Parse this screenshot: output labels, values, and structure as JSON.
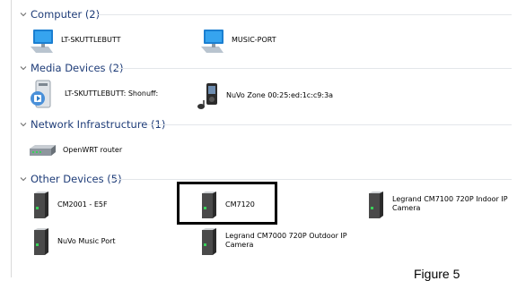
{
  "groups": [
    {
      "label": "Computer (2)",
      "icon": "chevron-down-icon"
    },
    {
      "label": "Media Devices (2)",
      "icon": "chevron-down-icon"
    },
    {
      "label": "Network Infrastructure (1)",
      "icon": "chevron-down-icon"
    },
    {
      "label": "Other Devices (5)",
      "icon": "chevron-down-icon"
    }
  ],
  "computers": [
    {
      "name": "LT-SKUTTLEBUTT",
      "icon": "computer-monitor-icon"
    },
    {
      "name": "MUSIC-PORT",
      "icon": "computer-monitor-icon"
    }
  ],
  "media": [
    {
      "name": "LT-SKUTTLEBUTT: Shonuff:",
      "icon": "media-server-icon"
    },
    {
      "name": "NuVo Zone 00:25:ed:1c:c9:3a",
      "icon": "media-player-icon"
    }
  ],
  "network": [
    {
      "name": "OpenWRT router",
      "icon": "router-icon"
    }
  ],
  "other": [
    {
      "name": "CM2001 - E5F",
      "icon": "generic-device-icon"
    },
    {
      "name": "CM7120",
      "icon": "generic-device-icon"
    },
    {
      "name": "Legrand CM7100 720P Indoor IP Camera",
      "icon": "generic-device-icon"
    },
    {
      "name": "NuVo Music Port",
      "icon": "generic-device-icon"
    },
    {
      "name": "Legrand CM7000 720P Outdoor IP Camera",
      "icon": "generic-device-icon"
    }
  ],
  "selection": {
    "item": "CM7120",
    "highlight_color": "#000000"
  },
  "caption": "Figure 5",
  "colors": {
    "group_header": "#1e3c78",
    "divider": "#e3e6ea"
  }
}
